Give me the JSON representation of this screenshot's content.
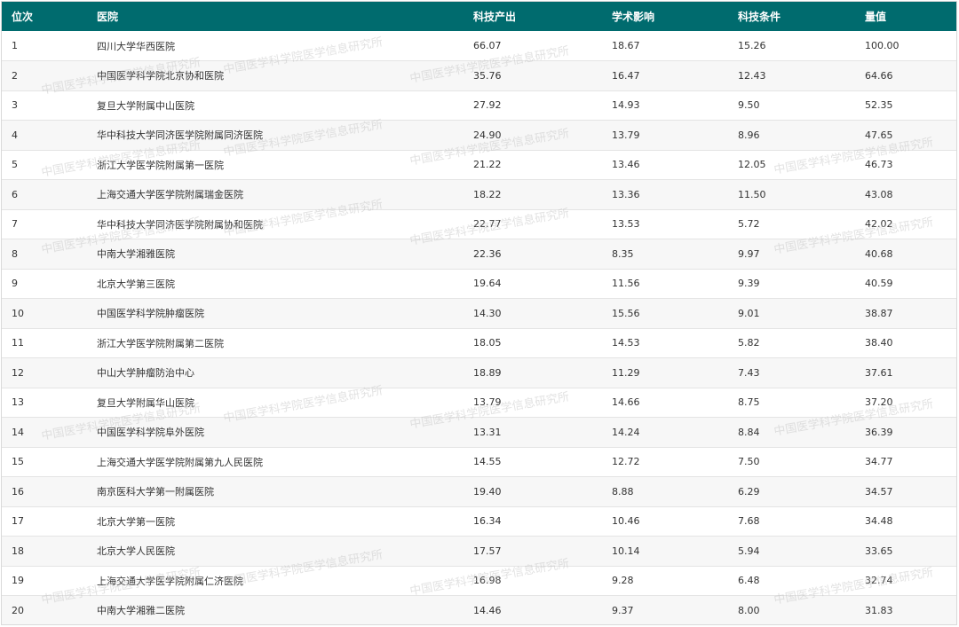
{
  "table": {
    "headers": [
      "位次",
      "医院",
      "科技产出",
      "学术影响",
      "科技条件",
      "量值"
    ],
    "rows": [
      [
        "1",
        "四川大学华西医院",
        "66.07",
        "18.67",
        "15.26",
        "100.00"
      ],
      [
        "2",
        "中国医学科学院北京协和医院",
        "35.76",
        "16.47",
        "12.43",
        "64.66"
      ],
      [
        "3",
        "复旦大学附属中山医院",
        "27.92",
        "14.93",
        "9.50",
        "52.35"
      ],
      [
        "4",
        "华中科技大学同济医学院附属同济医院",
        "24.90",
        "13.79",
        "8.96",
        "47.65"
      ],
      [
        "5",
        "浙江大学医学院附属第一医院",
        "21.22",
        "13.46",
        "12.05",
        "46.73"
      ],
      [
        "6",
        "上海交通大学医学院附属瑞金医院",
        "18.22",
        "13.36",
        "11.50",
        "43.08"
      ],
      [
        "7",
        "华中科技大学同济医学院附属协和医院",
        "22.77",
        "13.53",
        "5.72",
        "42.02"
      ],
      [
        "8",
        "中南大学湘雅医院",
        "22.36",
        "8.35",
        "9.97",
        "40.68"
      ],
      [
        "9",
        "北京大学第三医院",
        "19.64",
        "11.56",
        "9.39",
        "40.59"
      ],
      [
        "10",
        "中国医学科学院肿瘤医院",
        "14.30",
        "15.56",
        "9.01",
        "38.87"
      ],
      [
        "11",
        "浙江大学医学院附属第二医院",
        "18.05",
        "14.53",
        "5.82",
        "38.40"
      ],
      [
        "12",
        "中山大学肿瘤防治中心",
        "18.89",
        "11.29",
        "7.43",
        "37.61"
      ],
      [
        "13",
        "复旦大学附属华山医院",
        "13.79",
        "14.66",
        "8.75",
        "37.20"
      ],
      [
        "14",
        "中国医学科学院阜外医院",
        "13.31",
        "14.24",
        "8.84",
        "36.39"
      ],
      [
        "15",
        "上海交通大学医学院附属第九人民医院",
        "14.55",
        "12.72",
        "7.50",
        "34.77"
      ],
      [
        "16",
        "南京医科大学第一附属医院",
        "19.40",
        "8.88",
        "6.29",
        "34.57"
      ],
      [
        "17",
        "北京大学第一医院",
        "16.34",
        "10.46",
        "7.68",
        "34.48"
      ],
      [
        "18",
        "北京大学人民医院",
        "17.57",
        "10.14",
        "5.94",
        "33.65"
      ],
      [
        "19",
        "上海交通大学医学院附属仁济医院",
        "16.98",
        "9.28",
        "6.48",
        "32.74"
      ],
      [
        "20",
        "中南大学湘雅二医院",
        "14.46",
        "9.37",
        "8.00",
        "31.83"
      ]
    ]
  },
  "watermark": {
    "text": "中国医学科学院医学信息研究所"
  },
  "colors": {
    "header_bg": "#006b6e",
    "header_text": "#ffffff",
    "row_alt_bg": "#f7f7f7",
    "body_text": "#333333"
  }
}
